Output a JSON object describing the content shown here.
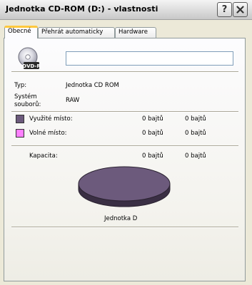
{
  "window": {
    "title": "Jednotka CD-ROM (D:) - vlastnosti",
    "help_label": "?",
    "close_icon": "close-icon"
  },
  "tabs": [
    {
      "label": "Obecné",
      "active": true
    },
    {
      "label": "Přehrát automaticky",
      "active": false
    },
    {
      "label": "Hardware",
      "active": false
    }
  ],
  "general": {
    "drive_icon": "cd-drive-icon",
    "drive_icon_badge": "DVD-R",
    "name_value": "",
    "type_label": "Typ:",
    "type_value": "Jednotka CD ROM",
    "fs_label_line1": "Systém",
    "fs_label_line2": "souborů:",
    "fs_value": "RAW",
    "used_label": "Využité místo:",
    "used_bytes": "0 bajtů",
    "used_size": "0 bajtů",
    "free_label": "Volné místo:",
    "free_bytes": "0 bajtů",
    "free_size": "0 bajtů",
    "capacity_label": "Kapacita:",
    "capacity_bytes": "0 bajtů",
    "capacity_size": "0 bajtů",
    "drive_caption": "Jednotka D"
  },
  "colors": {
    "used": "#6c5a7c",
    "free": "#ff80ff",
    "pie_top": "#6c5a7c",
    "pie_side": "#3a2f44"
  }
}
